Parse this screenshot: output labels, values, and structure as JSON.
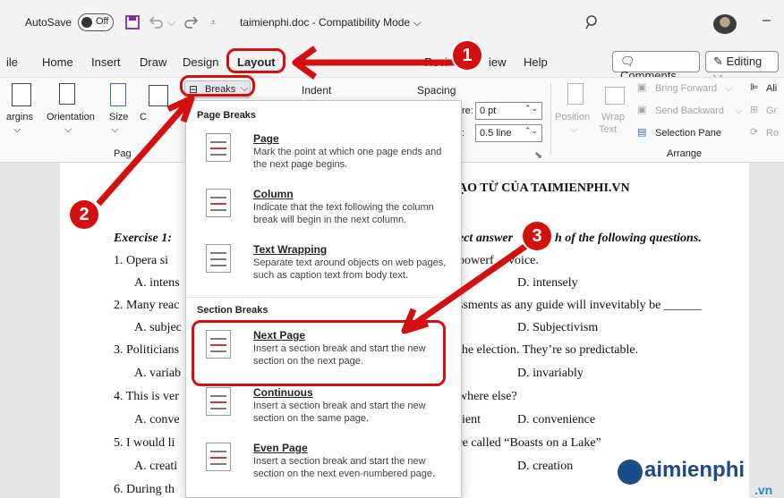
{
  "titlebar": {
    "autosave_label": "AutoSave",
    "autosave_state": "Off",
    "doc_title": "taimienphi.doc - Compatibility Mode",
    "chevron": "⌵",
    "icons": [
      "save-icon",
      "undo-icon",
      "redo-icon",
      "customize-icon",
      "search-icon",
      "avatar",
      "minimize-icon"
    ]
  },
  "tabs": {
    "items": [
      "ile",
      "Home",
      "Insert",
      "Draw",
      "Design",
      "Layout",
      "Revi",
      "iew",
      "Help"
    ],
    "active": "Layout",
    "comments_label": "Comments",
    "editing_label": "Editing",
    "editing_chevron": "⌵"
  },
  "ribbon": {
    "margins_label": "argins",
    "orientation_label": "Orientation",
    "size_label": "Size",
    "columns_label": "C",
    "group_page_setup": "Pag",
    "breaks_label": "Breaks",
    "indent_label": "Indent",
    "spacing_label": "Spacing",
    "before_label": "re:",
    "before_value": "0 pt",
    "after_value": "0.5 line",
    "position_label": "Position",
    "wrap_label": "Wrap",
    "wrap_label2": "Text",
    "bring_forward": "Bring Forward",
    "send_backward": "Send Backward",
    "selection_pane": "Selection Pane",
    "arrange_label": "Arrange",
    "align_label": "Ali",
    "group_label": "Gr",
    "rotate_label": "Ro"
  },
  "breaks_menu": {
    "page_breaks_heading": "Page Breaks",
    "section_breaks_heading": "Section Breaks",
    "items": [
      {
        "title": "Page",
        "desc": "Mark the point at which one page ends and the next page begins."
      },
      {
        "title": "Column",
        "desc": "Indicate that the text following the column break will begin in the next column."
      },
      {
        "title": "Text Wrapping",
        "desc": "Separate text around objects on web pages, such as caption text from body text."
      },
      {
        "title": "Next Page",
        "desc": "Insert a section break and start the new section on the next page."
      },
      {
        "title": "Continuous",
        "desc": "Insert a section break and start the new section on the same page."
      },
      {
        "title": "Even Page",
        "desc": "Insert a section break and start the new section on the next even-numbered page."
      }
    ]
  },
  "document": {
    "heading": "ẠO TỪ CỦA TAIMIENPHI.VN",
    "exercise_left": "Exercise 1: ",
    "exercise_right": "ect answer",
    "exercise_right2": "h of the following questions.",
    "q1_left": "1.   Opera si",
    "q1_right": "powerf",
    "q1_right2": " voice.",
    "q1a_left": "A. intens",
    "q1d": "D. intensely",
    "q2_left": "2. Many reac",
    "q2_right": "ssments as any guide will invevitably be ______",
    "q2a_left": "A. subjec",
    "q2d": "D. Subjectivism",
    "q3_left": "3. Politicians",
    "q3_right": "the election. They’re so predictable.",
    "q3a_left": "A. variab",
    "q3d": "D. invariably",
    "q4_left": "4. This is ver",
    "q4_right": "where else?",
    "q4a_left": "A. conve",
    "q4c": "ient",
    "q4d": "D. convenience",
    "q5_left": "5. I would li",
    "q5_right": "re called “Boasts on a Lake”",
    "q5a_left": "A. creati",
    "q5d": "D. creation",
    "q6_left": "6. During th"
  },
  "annotations": {
    "badge1": "1",
    "badge2": "2",
    "badge3": "3",
    "color": "#d40f0f"
  },
  "watermark": {
    "brand": "aimienphi",
    "tld": ".vn"
  }
}
